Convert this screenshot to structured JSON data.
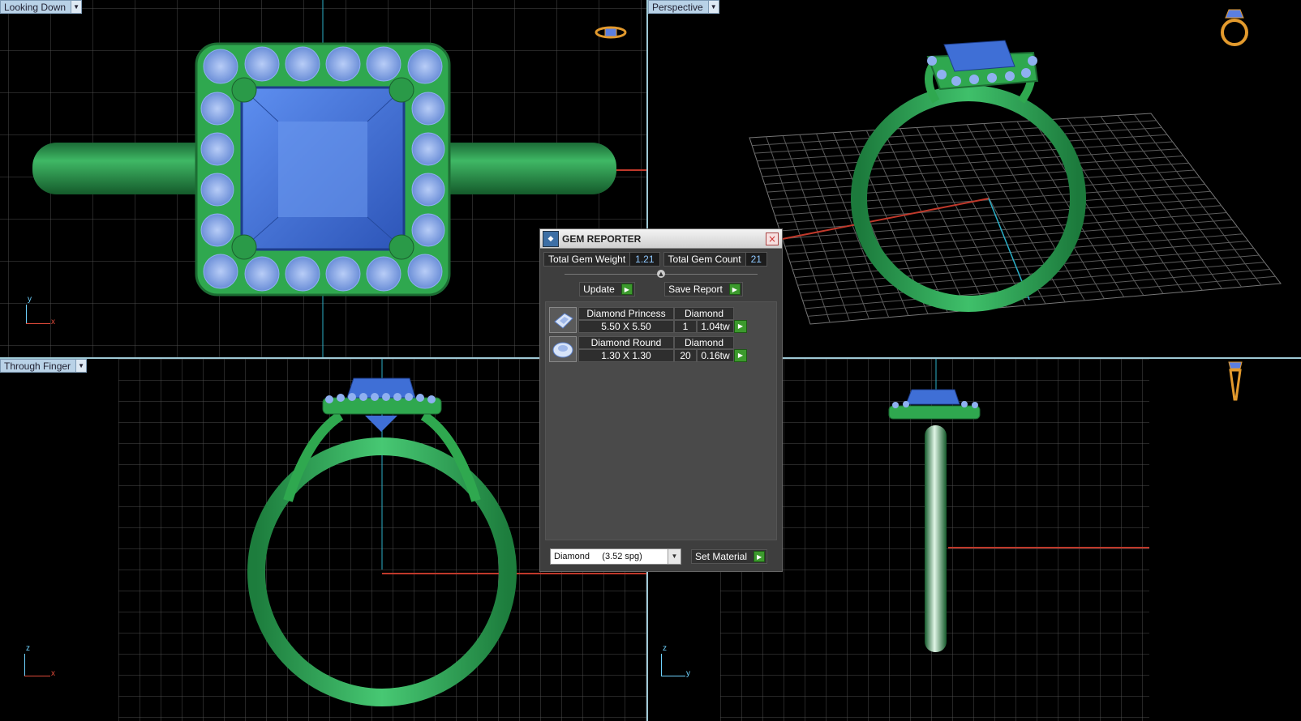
{
  "viewports": {
    "top_left": {
      "label": "Looking Down",
      "axis_v": "y",
      "axis_h": "x"
    },
    "top_right": {
      "label": "Perspective"
    },
    "bottom_left": {
      "label": "Through Finger",
      "axis_v": "z",
      "axis_h": "x"
    },
    "bottom_right": {
      "axis_v": "z",
      "axis_h": "y"
    }
  },
  "gem_reporter": {
    "title": "GEM REPORTER",
    "close_glyph": "×",
    "total_weight_label": "Total Gem Weight",
    "total_weight_value": "1.21",
    "total_count_label": "Total Gem Count",
    "total_count_value": "21",
    "update_label": "Update",
    "save_label": "Save Report",
    "gems": [
      {
        "name": "Diamond Princess",
        "material": "Diamond",
        "size": "5.50 X 5.50",
        "count": "1",
        "weight": "1.04tw",
        "icon": "princess-gem-icon"
      },
      {
        "name": "Diamond Round",
        "material": "Diamond",
        "size": "1.30 X 1.30",
        "count": "20",
        "weight": "0.16tw",
        "icon": "round-gem-icon"
      }
    ],
    "material_select_value": "Diamond     (3.52 spg)",
    "set_material_label": "Set Material"
  },
  "colors": {
    "metal": "#2fa84f",
    "gem": "#3f6fd6",
    "accent_button": "#3c9a2d",
    "grid": "#5a5a5a",
    "axis_red": "#c0392b",
    "axis_cyan": "#2bb0c8"
  }
}
